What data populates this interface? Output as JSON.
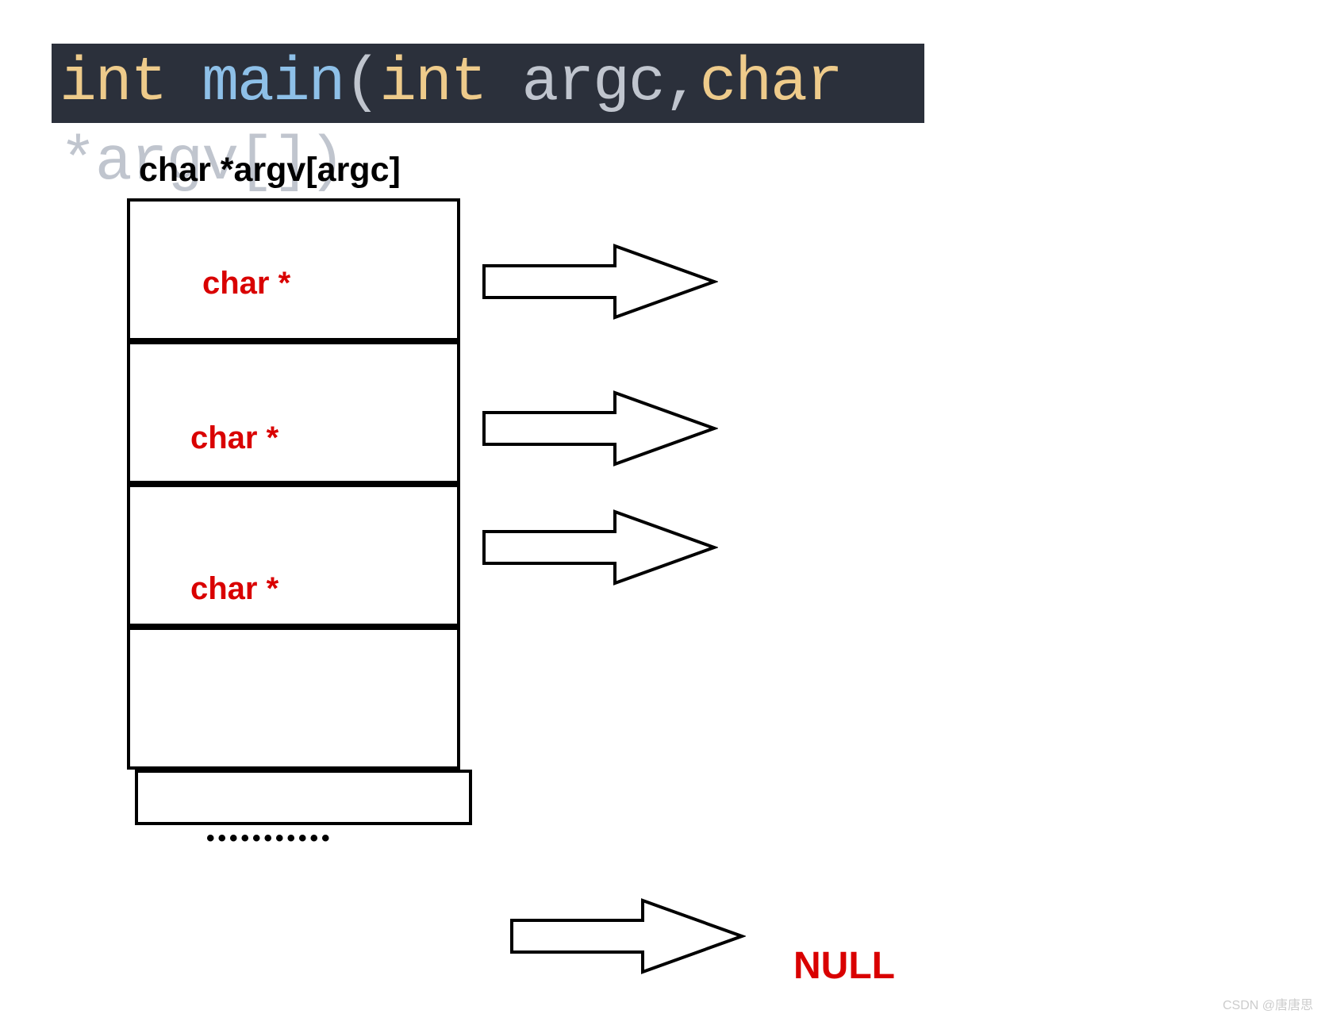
{
  "code": {
    "kw_int": "int ",
    "fn": "main",
    "after_fn": "(",
    "param1_type": "int ",
    "param1_name": "argc",
    "comma": ",",
    "param2_type": "char ",
    "star": "*",
    "param2_name": "argv",
    "brackets": "[]",
    "close": ")"
  },
  "diagram": {
    "title": "char *argv[argc]",
    "cells": {
      "c0": "char *",
      "c1": "char *",
      "c2": "char *"
    },
    "dots": "•••••••••••",
    "null_label": "NULL"
  },
  "watermark": "CSDN @唐唐思"
}
